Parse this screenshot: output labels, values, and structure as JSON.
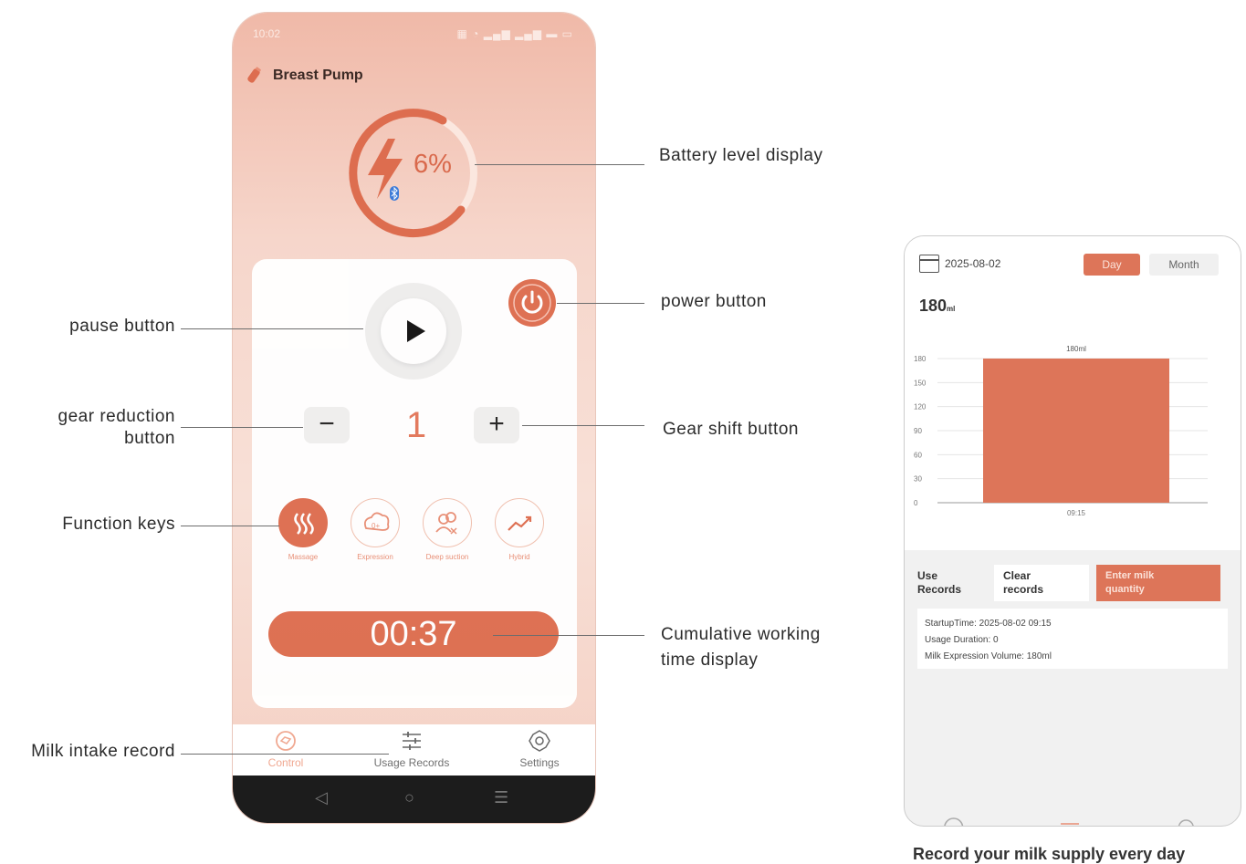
{
  "left_phone": {
    "status_time": "10:02",
    "status_icons": "▦ ◔ ▂▄▆ ▂▄▆ ▬ ▭",
    "app_title": "Breast Pump",
    "battery_percent": "6%",
    "battery_level": 6,
    "gear_value": "1",
    "gear_minus": "−",
    "gear_plus": "+",
    "function_keys": [
      {
        "label": "Massage",
        "icon": "massage-icon",
        "active": true
      },
      {
        "label": "Expression",
        "icon": "expression-icon",
        "active": false
      },
      {
        "label": "Deep suction",
        "icon": "deep-suction-icon",
        "active": false
      },
      {
        "label": "Hybrid",
        "icon": "hybrid-icon",
        "active": false
      }
    ],
    "timer": "00:37",
    "bottom_nav": [
      {
        "label": "Control",
        "icon": "control-icon",
        "active": true
      },
      {
        "label": "Usage Records",
        "icon": "sliders-icon",
        "active": false
      },
      {
        "label": "Settings",
        "icon": "gear-icon",
        "active": false
      }
    ],
    "system_nav": {
      "back": "◁",
      "home": "○",
      "menu": "☰"
    }
  },
  "callouts": {
    "battery": "Battery level display",
    "power": "power button",
    "pause": "pause button",
    "gear_reduction": [
      "gear reduction",
      "button"
    ],
    "gear_shift": "Gear shift button",
    "function_keys": "Function keys",
    "working_time": [
      "Cumulative working",
      "time display"
    ],
    "milk_record": "Milk intake record"
  },
  "right_phone": {
    "date": "2025-08-02",
    "tab_day": "Day",
    "tab_month": "Month",
    "total_value": "180",
    "total_unit": "ml",
    "actions": {
      "use_records": [
        "Use",
        "Records"
      ],
      "clear_records": [
        "Clear",
        "records"
      ],
      "enter_milk": [
        "Enter milk",
        "quantity"
      ]
    },
    "record_lines": [
      "StartupTime: 2025-08-02 09:15",
      "Usage Duration: 0",
      "Milk Expression Volume: 180ml"
    ],
    "caption": "Record your milk supply every day"
  },
  "colors": {
    "accent": "#dd6d4f",
    "accent_light": "#f0bfae",
    "bar": "#dd7559"
  },
  "chart_data": {
    "type": "bar",
    "categories": [
      "09:15"
    ],
    "values": [
      180
    ],
    "data_labels": [
      "180ml"
    ],
    "yticks": [
      0,
      30,
      60,
      90,
      120,
      150,
      180
    ],
    "ylim": [
      0,
      180
    ],
    "grid": true
  }
}
